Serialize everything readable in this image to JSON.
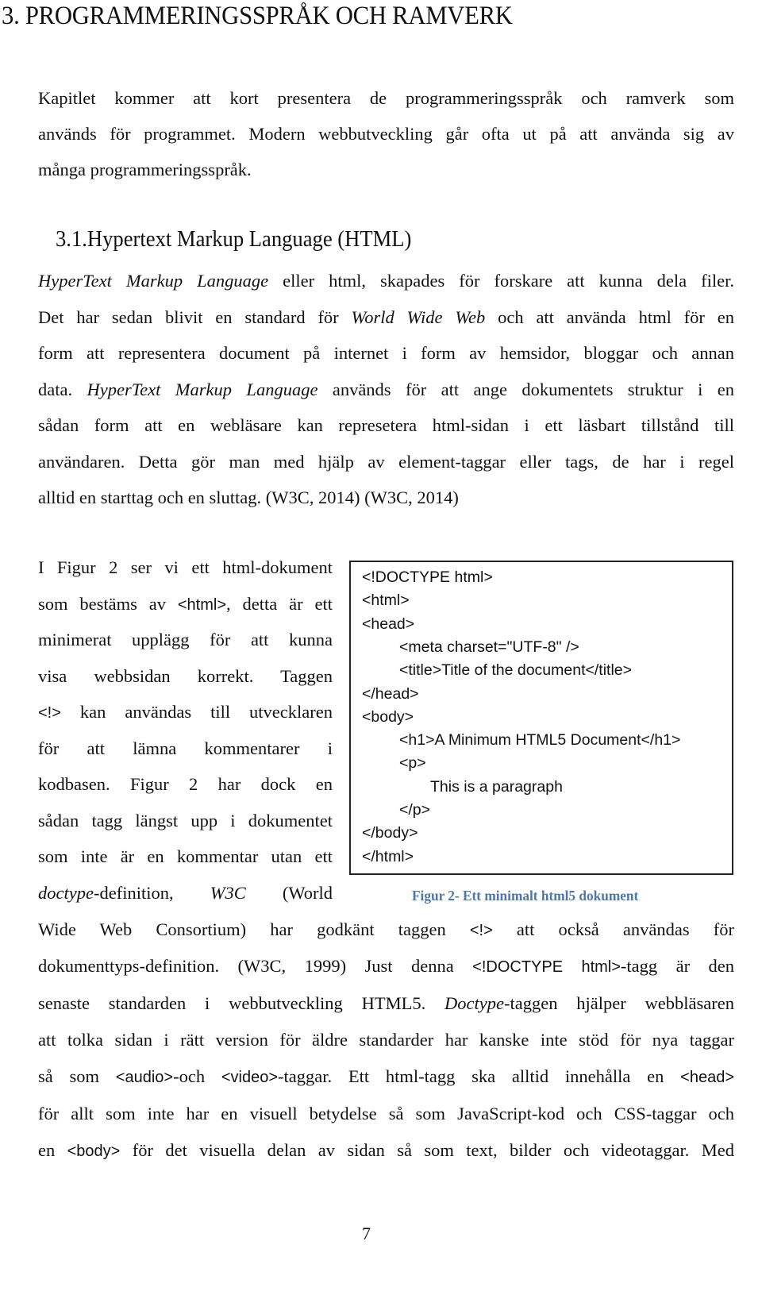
{
  "chapter_title": "3. PROGRAMMERINGSSPRÅK OCH RAMVERK",
  "intro_lines": [
    "Kapitlet kommer att kort presentera de programmeringsspråk och ramverk som",
    "används för programmet. Modern webbutveckling går ofta ut på att använda sig av",
    "många programmeringsspråk."
  ],
  "section_title": "3.1.Hypertext Markup Language (HTML)",
  "section_para": [
    {
      "parts": [
        {
          "t": "HyperText Markup Language",
          "i": true
        },
        {
          "t": " eller html, skapades för forskare att kunna dela filer."
        }
      ]
    },
    {
      "parts": [
        {
          "t": "Det har sedan blivit en standard för "
        },
        {
          "t": "World Wide Web",
          "i": true
        },
        {
          "t": " och att använda html för en"
        }
      ]
    },
    {
      "parts": [
        {
          "t": "form att representera document på internet i form av hemsidor, bloggar och annan"
        }
      ]
    },
    {
      "parts": [
        {
          "t": "data. "
        },
        {
          "t": "HyperText Markup Language",
          "i": true
        },
        {
          "t": " används för att ange dokumentets struktur i en"
        }
      ]
    },
    {
      "parts": [
        {
          "t": "sådan form att en webläsare kan represetera html-sidan i ett läsbart tillstånd till"
        }
      ]
    },
    {
      "parts": [
        {
          "t": "användaren. Detta gör man med hjälp av element-taggar eller tags, de har i regel"
        }
      ]
    },
    {
      "parts": [
        {
          "t": "alltid en starttag och en sluttag. (W3C, 2014) (W3C, 2014)"
        }
      ],
      "last": true
    }
  ],
  "figure_text_lines": [
    {
      "parts": [
        {
          "t": "I Figur 2 ser vi ett html-dokument"
        }
      ]
    },
    {
      "parts": [
        {
          "t": "som bestäms av "
        },
        {
          "t": "<html>",
          "m": true
        },
        {
          "t": ", detta är ett"
        }
      ]
    },
    {
      "parts": [
        {
          "t": "minimerat upplägg för att kunna"
        }
      ]
    },
    {
      "parts": [
        {
          "t": "visa webbsidan korrekt. Taggen"
        }
      ]
    },
    {
      "parts": [
        {
          "t": "<!>",
          "m": true
        },
        {
          "t": " kan användas till utvecklaren"
        }
      ]
    },
    {
      "parts": [
        {
          "t": "för att lämna kommentarer i"
        }
      ]
    },
    {
      "parts": [
        {
          "t": "kodbasen. Figur 2 har dock en"
        }
      ]
    },
    {
      "parts": [
        {
          "t": "sådan tagg längst upp i dokumentet"
        }
      ]
    },
    {
      "parts": [
        {
          "t": "som inte är en kommentar utan ett"
        }
      ]
    },
    {
      "parts": [
        {
          "t": "doctype",
          "i": true
        },
        {
          "t": "-definition, "
        },
        {
          "t": "W3C",
          "i": true
        },
        {
          "t": " (World"
        }
      ]
    }
  ],
  "code_lines": [
    {
      "indent": 0,
      "text": "<!DOCTYPE html>"
    },
    {
      "indent": 0,
      "text": "<html>"
    },
    {
      "indent": 0,
      "text": "<head>"
    },
    {
      "indent": 1,
      "text": "<meta charset=\"UTF-8\" />"
    },
    {
      "indent": 1,
      "text": "<title>Title of the document</title>"
    },
    {
      "indent": 0,
      "text": "</head>"
    },
    {
      "indent": 0,
      "text": "<body>"
    },
    {
      "indent": 1,
      "text": "<h1>A Minimum HTML5 Document</h1>"
    },
    {
      "indent": 1,
      "text": "<p>"
    },
    {
      "indent": 2,
      "text": "This is a paragraph"
    },
    {
      "indent": 1,
      "text": "</p>"
    },
    {
      "indent": 0,
      "text": "</body>"
    },
    {
      "indent": 0,
      "text": "</html>"
    }
  ],
  "figure_caption": "Figur 2- Ett minimalt html5 dokument",
  "caption_color": "#4f76a9",
  "after_lines": [
    {
      "parts": [
        {
          "t": "Wide Web Consortium) har godkänt taggen "
        },
        {
          "t": "<!>",
          "m": true
        },
        {
          "t": " att också användas för"
        }
      ]
    },
    {
      "parts": [
        {
          "t": "dokumenttyps-definition. (W3C, 1999) Just denna "
        },
        {
          "t": "<!DOCTYPE html>",
          "m": true
        },
        {
          "t": "-tagg är den"
        }
      ]
    },
    {
      "parts": [
        {
          "t": "senaste standarden i webbutveckling HTML5. "
        },
        {
          "t": "Doctype",
          "i": true
        },
        {
          "t": "-taggen hjälper webbläsaren"
        }
      ]
    },
    {
      "parts": [
        {
          "t": "att tolka sidan i rätt version för äldre standarder har kanske inte stöd för nya taggar"
        }
      ]
    },
    {
      "parts": [
        {
          "t": "så som "
        },
        {
          "t": "<audio>",
          "m": true
        },
        {
          "t": "-och "
        },
        {
          "t": "<video>",
          "m": true
        },
        {
          "t": "-taggar. Ett html-tagg ska alltid innehålla en "
        },
        {
          "t": "<head>",
          "m": true
        }
      ]
    },
    {
      "parts": [
        {
          "t": "för allt som inte har en visuell betydelse så som JavaScript-kod och CSS-taggar och"
        }
      ]
    },
    {
      "parts": [
        {
          "t": "en "
        },
        {
          "t": "<body>",
          "m": true
        },
        {
          "t": " för det visuella delan av sidan så som text, bilder och videotaggar. Med"
        }
      ]
    }
  ],
  "page_number": "7"
}
